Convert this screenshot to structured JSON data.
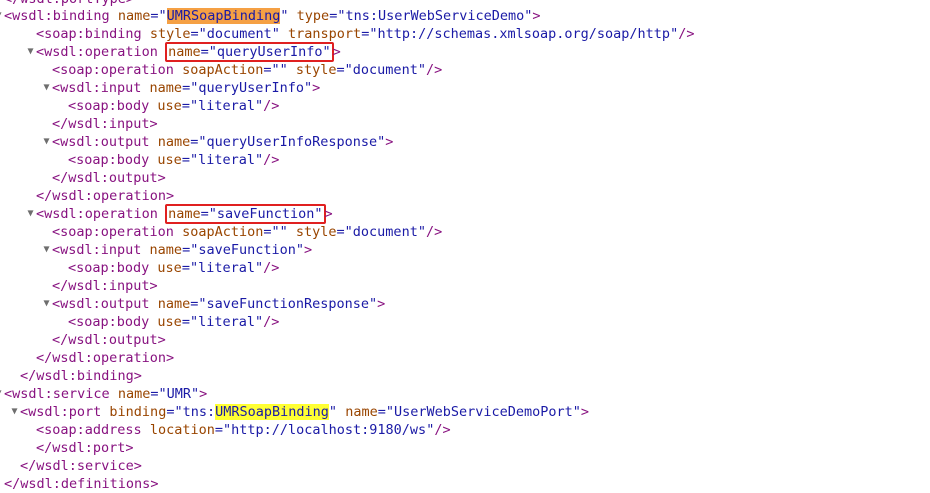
{
  "lines": [
    {
      "text": "</wsdl:portType>"
    },
    {
      "text": "<wsdl:binding name=\"UMRSoapBinding\" type=\"tns:UserWebServiceDemo\">"
    },
    {
      "text": "<soap:binding style=\"document\" transport=\"http://schemas.xmlsoap.org/soap/http\"/>"
    },
    {
      "text": "<wsdl:operation name=\"queryUserInfo\">"
    },
    {
      "text": "<soap:operation soapAction=\"\" style=\"document\"/>"
    },
    {
      "text": "<wsdl:input name=\"queryUserInfo\">"
    },
    {
      "text": "<soap:body use=\"literal\"/>"
    },
    {
      "text": "</wsdl:input>"
    },
    {
      "text": "<wsdl:output name=\"queryUserInfoResponse\">"
    },
    {
      "text": "<soap:body use=\"literal\"/>"
    },
    {
      "text": "</wsdl:output>"
    },
    {
      "text": "</wsdl:operation>"
    },
    {
      "text": "<wsdl:operation name=\"saveFunction\">"
    },
    {
      "text": "<soap:operation soapAction=\"\" style=\"document\"/>"
    },
    {
      "text": "<wsdl:input name=\"saveFunction\">"
    },
    {
      "text": "<soap:body use=\"literal\"/>"
    },
    {
      "text": "</wsdl:input>"
    },
    {
      "text": "<wsdl:output name=\"saveFunctionResponse\">"
    },
    {
      "text": "<soap:body use=\"literal\"/>"
    },
    {
      "text": "</wsdl:output>"
    },
    {
      "text": "</wsdl:operation>"
    },
    {
      "text": "</wsdl:binding>"
    },
    {
      "text": "<wsdl:service name=\"UMR\">"
    },
    {
      "text": "<wsdl:port binding=\"tns:UMRSoapBinding\" name=\"UserWebServiceDemoPort\">"
    },
    {
      "text": "<soap:address location=\"http://localhost:9180/ws\"/>"
    },
    {
      "text": "</wsdl:port>"
    },
    {
      "text": "</wsdl:service>"
    },
    {
      "text": "</wsdl:definitions>"
    }
  ],
  "toggle_glyph": "▼",
  "colors": {
    "tag": "#881280",
    "attr_name": "#994500",
    "attr_value": "#1a1aa6",
    "highlight_orange": "#f5a044",
    "highlight_yellow": "#ffff33",
    "annotation_box": "#e02020"
  }
}
